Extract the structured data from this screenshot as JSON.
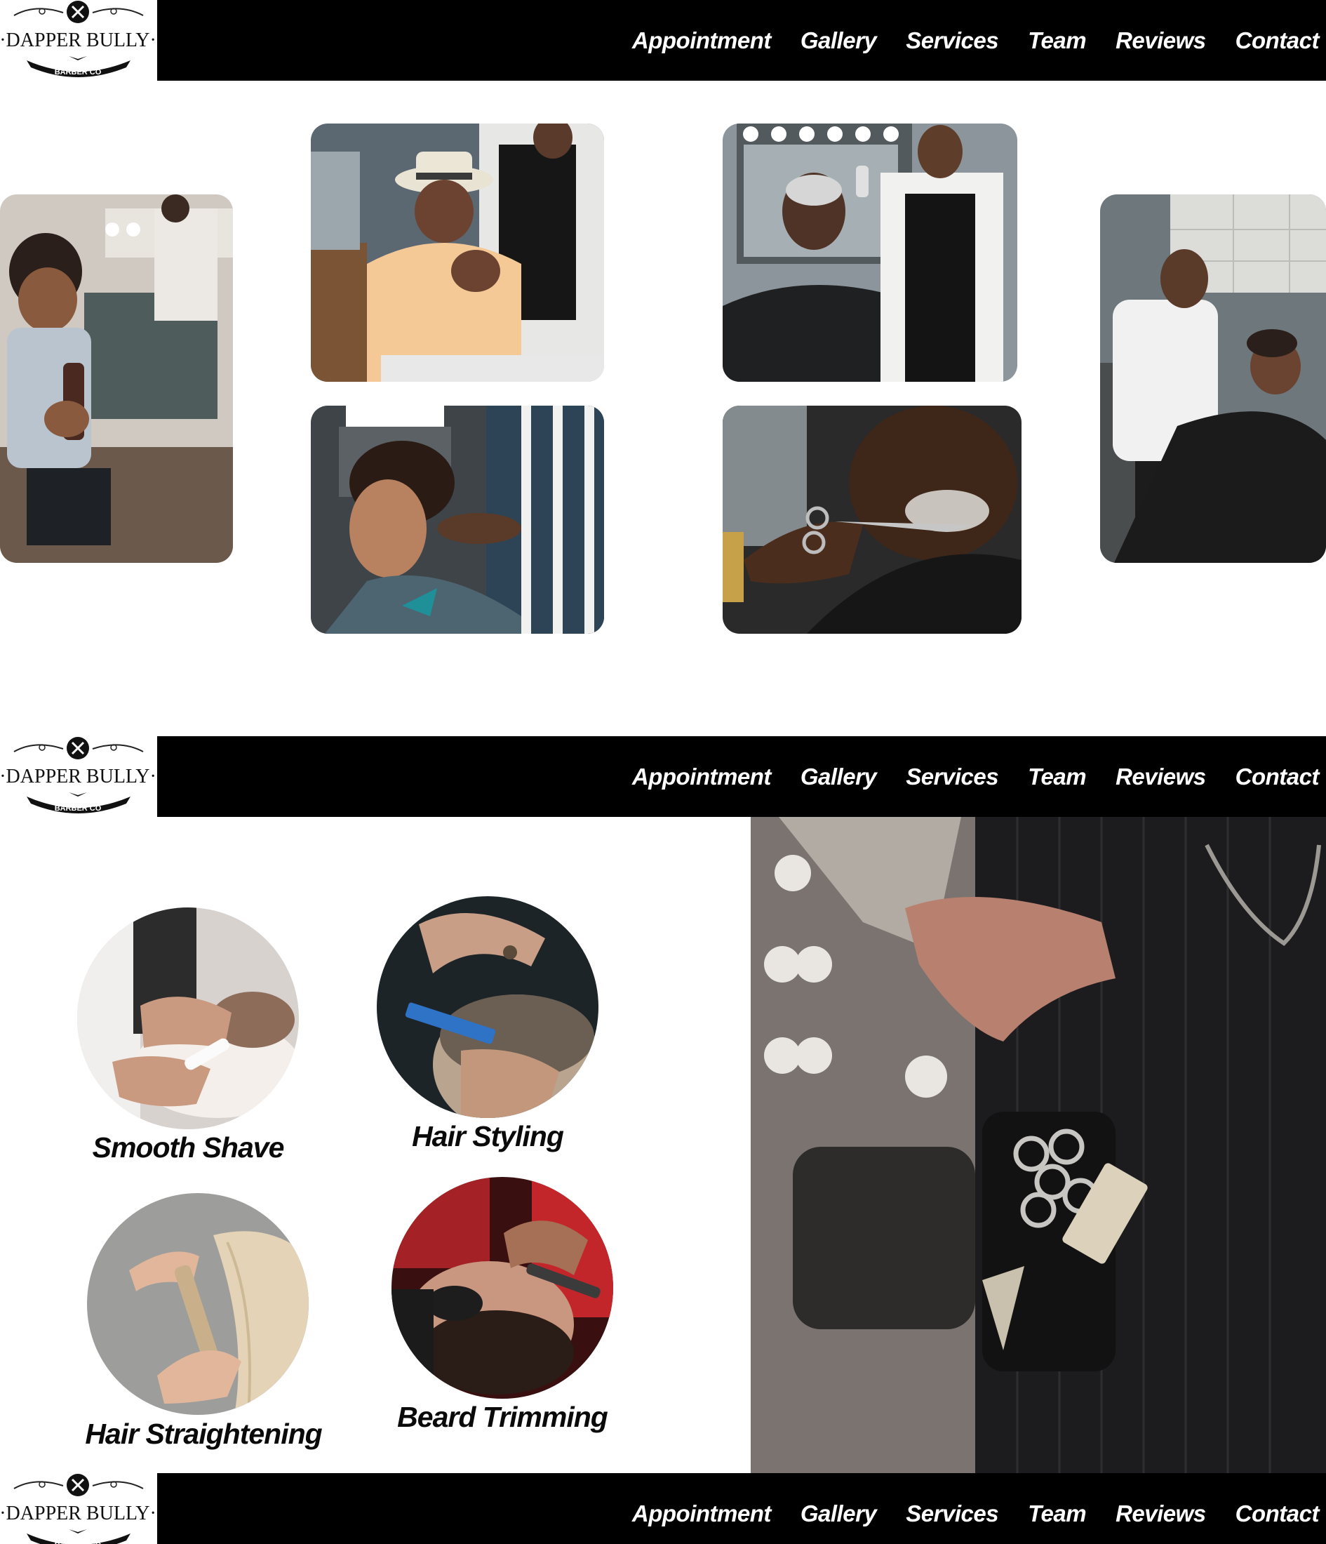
{
  "brand": {
    "name": "DAPPER BULLY",
    "tagline": "BARBER CO"
  },
  "nav": {
    "items": [
      "Appointment",
      "Gallery",
      "Services",
      "Team",
      "Reviews",
      "Contact"
    ]
  },
  "gallery": {
    "photos": [
      "boy-with-brush-photo",
      "man-in-hat-photo",
      "elder-man-smiling-photo",
      "barber-with-boy-photo",
      "teen-haircut-photo",
      "beard-scissors-photo"
    ]
  },
  "services": {
    "items": [
      {
        "label": "Smooth Shave"
      },
      {
        "label": "Hair Styling"
      },
      {
        "label": "Hair Straightening"
      },
      {
        "label": "Beard Trimming"
      }
    ]
  },
  "colors": {
    "header_bg": "#000000",
    "nav_text": "#ffffff",
    "page_bg": "#ffffff",
    "label_text": "#0a0a0a"
  }
}
